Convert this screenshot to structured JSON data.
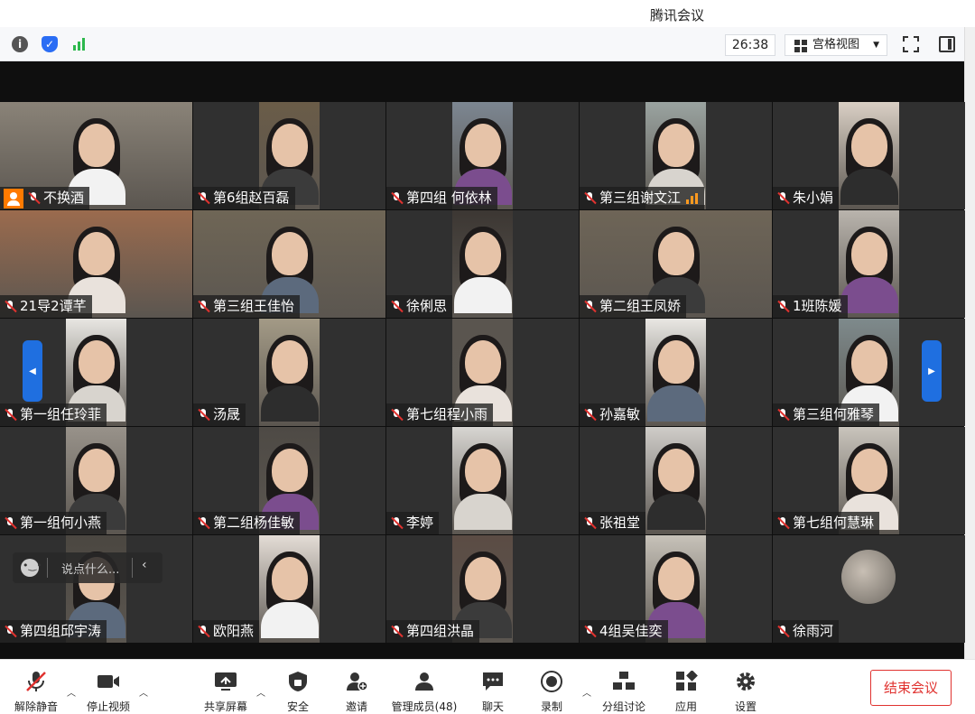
{
  "window": {
    "title": "腾讯会议"
  },
  "infobar": {
    "timer": "26:38",
    "view_label": "宫格视图"
  },
  "chat": {
    "placeholder": "说点什么..."
  },
  "participants": [
    {
      "name": "不换酒",
      "host": true,
      "bg": "#8a8378"
    },
    {
      "name": "第6组赵百磊",
      "bg": "#6a5c48"
    },
    {
      "name": "第四组 何依林",
      "bg": "#7c8691"
    },
    {
      "name": "第三组谢文江",
      "speaking": true,
      "bg": "#9aa3a0"
    },
    {
      "name": "朱小娟",
      "bg": "#d9cfc4"
    },
    {
      "name": "21导2谭芊",
      "bg": "#9b6b4e"
    },
    {
      "name": "第三组王佳怡",
      "bg": "#6f6656"
    },
    {
      "name": "徐俐思",
      "bg": "#3c3733"
    },
    {
      "name": "第二组王凤娇",
      "bg": "#6e6557"
    },
    {
      "name": "1班陈媛",
      "bg": "#b9b4ad"
    },
    {
      "name": "第一组任玲菲",
      "bg": "#e8e6e2"
    },
    {
      "name": "汤晟",
      "bg": "#a39a86"
    },
    {
      "name": "第七组程小雨",
      "bg": "#5a554f"
    },
    {
      "name": "孙嘉敏",
      "bg": "#e9e7e3"
    },
    {
      "name": "第三组何雅琴",
      "bg": "#7e8a8c"
    },
    {
      "name": "第一组何小燕",
      "bg": "#98928a"
    },
    {
      "name": "第二组杨佳敏",
      "bg": "#4e4a45"
    },
    {
      "name": "李婷",
      "bg": "#d8d6d2"
    },
    {
      "name": "张祖堂",
      "bg": "#cfcdc9"
    },
    {
      "name": "第七组何慧琳",
      "bg": "#c9c4bc"
    },
    {
      "name": "第四组邱宇涛",
      "bg": "#4b4741"
    },
    {
      "name": "欧阳燕",
      "bg": "#e4ddd6"
    },
    {
      "name": "第四组洪晶",
      "bg": "#5b4c44"
    },
    {
      "name": "4组吴佳奕",
      "bg": "#c7c2b9"
    },
    {
      "name": "徐雨河",
      "avatar_only": true,
      "bg": "#303030"
    }
  ],
  "toolbar": {
    "unmute": "解除静音",
    "stop_video": "停止视频",
    "share_screen": "共享屏幕",
    "security": "安全",
    "invite": "邀请",
    "manage_members": "管理成员(48)",
    "chat": "聊天",
    "record": "录制",
    "breakout": "分组讨论",
    "apps": "应用",
    "settings": "设置",
    "end_meeting": "结束会议"
  }
}
